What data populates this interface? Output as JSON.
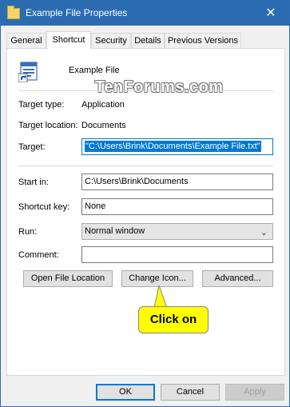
{
  "window": {
    "title": "Example File Properties",
    "close_glyph": "✕"
  },
  "tabs": [
    {
      "label": "General"
    },
    {
      "label": "Shortcut"
    },
    {
      "label": "Security"
    },
    {
      "label": "Details"
    },
    {
      "label": "Previous Versions"
    }
  ],
  "file": {
    "name": "Example File",
    "icon": "document-shortcut-icon"
  },
  "watermark": "TenForums.com",
  "info": {
    "target_type_label": "Target type:",
    "target_type_value": "Application",
    "target_location_label": "Target location:",
    "target_location_value": "Documents"
  },
  "fields": {
    "target_label": "Target:",
    "target_value": "\"C:\\Users\\Brink\\Documents\\Example File.txt\"",
    "start_in_label": "Start in:",
    "start_in_value": "C:\\Users\\Brink\\Documents",
    "shortcut_key_label": "Shortcut key:",
    "shortcut_key_value": "None",
    "run_label": "Run:",
    "run_value": "Normal window",
    "comment_label": "Comment:",
    "comment_value": ""
  },
  "actions": {
    "open_file_location": "Open File Location",
    "change_icon": "Change Icon...",
    "advanced": "Advanced..."
  },
  "callout": "Click on",
  "footer": {
    "ok": "OK",
    "cancel": "Cancel",
    "apply": "Apply"
  },
  "colors": {
    "titlebar": "#2b6cb0",
    "accent": "#0078d7",
    "callout": "#ffff00"
  }
}
